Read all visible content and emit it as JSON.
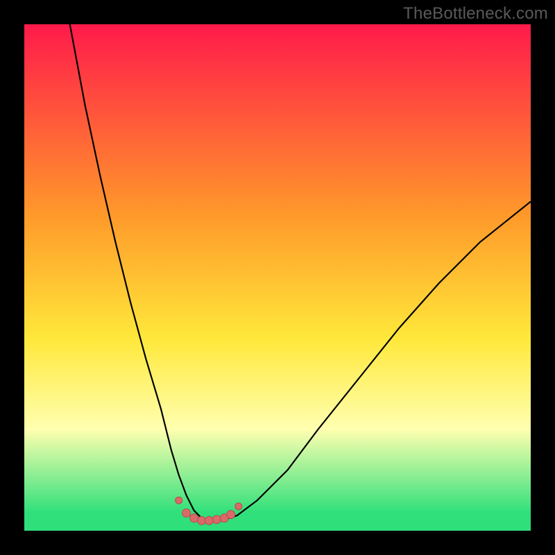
{
  "watermark": "TheBottleneck.com",
  "colors": {
    "black": "#000000",
    "red_top": "#ff1a4a",
    "orange": "#ff9a2a",
    "yellow": "#ffe83a",
    "pale_yellow": "#ffffb0",
    "green": "#2fe07a",
    "curve": "#000000",
    "marker_fill": "#d86a6a",
    "marker_stroke": "#b84a4a"
  },
  "chart_data": {
    "type": "line",
    "title": "",
    "xlabel": "",
    "ylabel": "",
    "xlim": [
      0,
      100
    ],
    "ylim": [
      0,
      100
    ],
    "series": [
      {
        "name": "curve",
        "x": [
          9,
          12,
          15,
          18,
          21,
          24,
          27,
          29,
          30.5,
          32,
          33.5,
          35,
          37,
          39,
          42,
          46,
          52,
          58,
          66,
          74,
          82,
          90,
          100
        ],
        "y": [
          100,
          84,
          70,
          57,
          45,
          34,
          24,
          16,
          11,
          7,
          4,
          2.5,
          2,
          2,
          3,
          6,
          12,
          20,
          30,
          40,
          49,
          57,
          65
        ]
      }
    ],
    "markers": {
      "name": "bottom-markers",
      "points": [
        {
          "x": 30.5,
          "y": 6,
          "r": 5
        },
        {
          "x": 32,
          "y": 3.5,
          "r": 6
        },
        {
          "x": 33.5,
          "y": 2.5,
          "r": 6
        },
        {
          "x": 35,
          "y": 2,
          "r": 6
        },
        {
          "x": 36.5,
          "y": 2,
          "r": 6
        },
        {
          "x": 38,
          "y": 2.2,
          "r": 6
        },
        {
          "x": 39.5,
          "y": 2.5,
          "r": 6
        },
        {
          "x": 40.8,
          "y": 3.2,
          "r": 6
        },
        {
          "x": 42.3,
          "y": 4.8,
          "r": 5
        }
      ]
    },
    "gradient_stops": [
      {
        "offset": 0.0,
        "color_key": "red_top"
      },
      {
        "offset": 0.38,
        "color_key": "orange"
      },
      {
        "offset": 0.62,
        "color_key": "yellow"
      },
      {
        "offset": 0.8,
        "color_key": "pale_yellow"
      },
      {
        "offset": 0.965,
        "color_key": "green"
      },
      {
        "offset": 1.0,
        "color_key": "green"
      }
    ]
  }
}
